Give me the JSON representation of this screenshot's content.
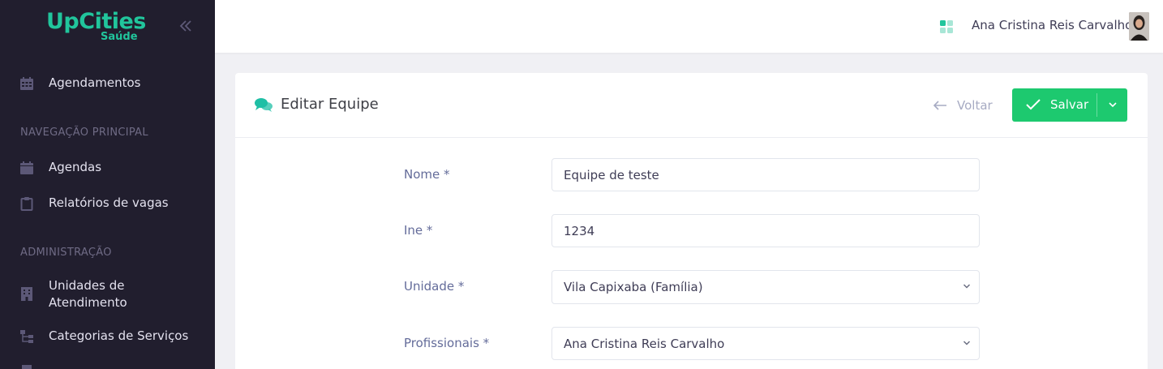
{
  "brand": {
    "name": "UpCities",
    "sub": "Saúde",
    "color": "#21c59c"
  },
  "sidebar": {
    "top_item": {
      "label": "Agendamentos",
      "icon": "calendar-icon"
    },
    "sections": [
      {
        "title": "NAVEGAÇÃO PRINCIPAL",
        "items": [
          {
            "label": "Agendas",
            "icon": "calendar-icon"
          },
          {
            "label": "Relatórios de vagas",
            "icon": "clipboard-icon"
          }
        ]
      },
      {
        "title": "ADMINISTRAÇÃO",
        "items": [
          {
            "label": "Unidades de Atendimento",
            "icon": "building-icon"
          },
          {
            "label": "Categorias de Serviços",
            "icon": "sitemap-icon"
          }
        ]
      }
    ]
  },
  "topbar": {
    "user_name": "Ana Cristina Reis Carvalho"
  },
  "page": {
    "title": "Editar Equipe",
    "back_label": "Voltar",
    "save_label": "Salvar",
    "accent": "#1dc96f"
  },
  "form": {
    "nome": {
      "label": "Nome *",
      "value": "Equipe de teste"
    },
    "ine": {
      "label": "Ine *",
      "value": "1234"
    },
    "unidade": {
      "label": "Unidade *",
      "value": "Vila Capixaba (Família)"
    },
    "profissionais": {
      "label": "Profissionais *",
      "value": "Ana Cristina Reis Carvalho"
    }
  }
}
